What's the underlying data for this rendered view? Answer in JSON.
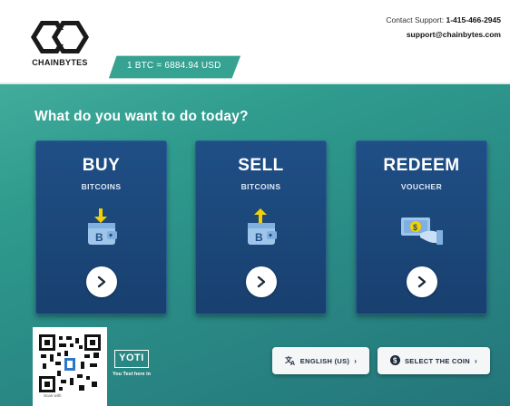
{
  "brand": {
    "name": "CHAINBYTES",
    "logo_icon": "chainbytes-hex-logo",
    "accent": "#2f9c8e",
    "card_color": "#1f4f86"
  },
  "contact": {
    "label": "Contact Support:",
    "phone": "1-415-466-2945",
    "email": "support@chainbytes.com"
  },
  "rate": {
    "text": "1 BTC = 6884.94 USD"
  },
  "prompt": "What do you want to do today?",
  "actions": [
    {
      "title": "BUY",
      "subtitle": "BITCOINS",
      "icon": "wallet-receive-icon"
    },
    {
      "title": "SELL",
      "subtitle": "BITCOINS",
      "icon": "wallet-send-icon"
    },
    {
      "title": "REDEEM",
      "subtitle": "VOUCHER",
      "icon": "cash-in-hand-icon"
    }
  ],
  "yoti": {
    "logo": "YOTI",
    "caption": "You Test here in"
  },
  "qr": {
    "caption": "Scan with"
  },
  "footer": {
    "language_label": "ENGLISH (US)",
    "coin_label": "SELECT THE COIN"
  }
}
